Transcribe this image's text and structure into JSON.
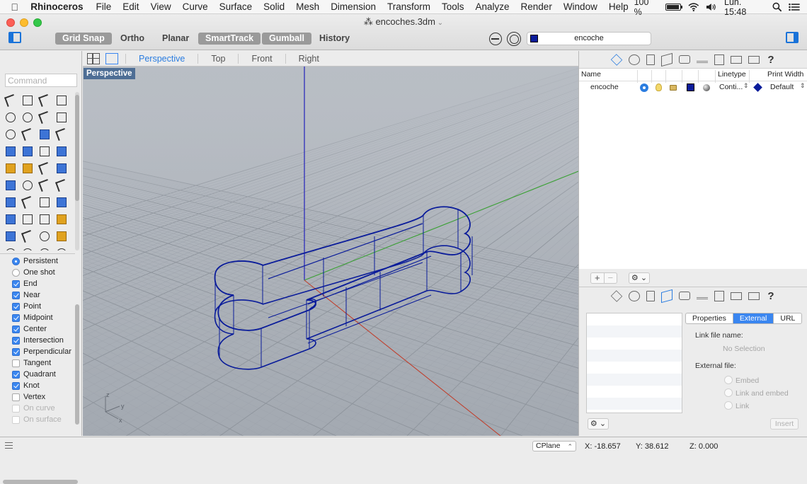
{
  "menubar": {
    "app_name": "Rhinoceros",
    "items": [
      "File",
      "Edit",
      "View",
      "Curve",
      "Surface",
      "Solid",
      "Mesh",
      "Dimension",
      "Transform",
      "Tools",
      "Analyze",
      "Render",
      "Window",
      "Help"
    ],
    "battery": "100 %",
    "clock": "Lun. 15:48"
  },
  "window": {
    "title": "encoches.3dm",
    "modes": {
      "grid_snap": "Grid Snap",
      "ortho": "Ortho",
      "planar": "Planar",
      "smarttrack": "SmartTrack",
      "gumball": "Gumball",
      "history": "History"
    },
    "current_layer": "encoche"
  },
  "command": {
    "placeholder": "Command"
  },
  "osnap": {
    "modes": [
      {
        "label": "Persistent",
        "type": "radio",
        "checked": true
      },
      {
        "label": "One shot",
        "type": "radio",
        "checked": false
      },
      {
        "label": "End",
        "type": "check",
        "checked": true
      },
      {
        "label": "Near",
        "type": "check",
        "checked": true
      },
      {
        "label": "Point",
        "type": "check",
        "checked": true
      },
      {
        "label": "Midpoint",
        "type": "check",
        "checked": true
      },
      {
        "label": "Center",
        "type": "check",
        "checked": true
      },
      {
        "label": "Intersection",
        "type": "check",
        "checked": true
      },
      {
        "label": "Perpendicular",
        "type": "check",
        "checked": true
      },
      {
        "label": "Tangent",
        "type": "check",
        "checked": false
      },
      {
        "label": "Quadrant",
        "type": "check",
        "checked": true
      },
      {
        "label": "Knot",
        "type": "check",
        "checked": true
      },
      {
        "label": "Vertex",
        "type": "check",
        "checked": false
      },
      {
        "label": "On curve",
        "type": "check",
        "checked": false,
        "disabled": true
      },
      {
        "label": "On surface",
        "type": "check",
        "checked": false,
        "disabled": true
      }
    ]
  },
  "viewport": {
    "tabs": [
      "Perspective",
      "Top",
      "Front",
      "Right"
    ],
    "active_tab": "Perspective",
    "label": "Perspective",
    "axis_labels": {
      "z": "z",
      "y": "y",
      "x": "x"
    }
  },
  "layers": {
    "columns": {
      "name": "Name",
      "linetype": "Linetype",
      "print_width": "Print Width"
    },
    "rows": [
      {
        "name": "encoche",
        "linetype": "Conti...",
        "print_width": "Default",
        "color": "#0a1c9a"
      }
    ]
  },
  "properties": {
    "tabs": [
      "Properties",
      "External",
      "URL"
    ],
    "active_tab": "External",
    "link_file_name_label": "Link file name:",
    "no_selection": "No Selection",
    "external_file_label": "External file:",
    "options": [
      "Embed",
      "Link and embed",
      "Link"
    ],
    "insert_button": "Insert"
  },
  "status": {
    "cplane": "CPlane",
    "x": "X: -18.657",
    "y": "Y: 38.612",
    "z": "Z: 0.000"
  },
  "colors": {
    "accent": "#3a86f0",
    "object_wire": "#0a1c9a",
    "viewport_bg": "#aab0b8",
    "x_axis": "#c0402e",
    "y_axis": "#3aa034",
    "z_axis": "#2d2dbb"
  }
}
